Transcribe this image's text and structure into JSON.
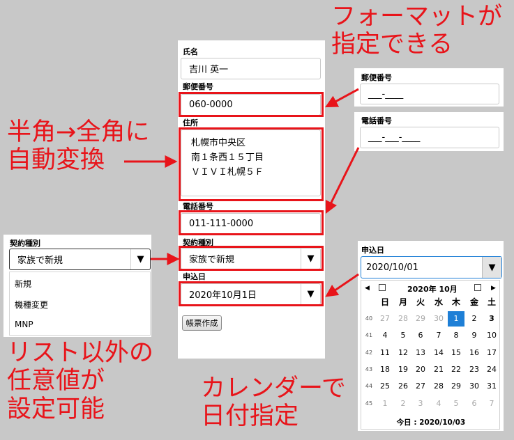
{
  "main_form": {
    "name_label": "氏名",
    "name_value": "吉川 英一",
    "postal_label": "郵便番号",
    "postal_value": "060-0000",
    "address_label": "住所",
    "address_lines": [
      "札幌市中央区",
      "南１条西１５丁目",
      "ＶＩＶＩ札幌５Ｆ"
    ],
    "phone_label": "電話番号",
    "phone_value": "011-111-0000",
    "contract_label": "契約種別",
    "contract_value": "家族で新規",
    "apply_label": "申込日",
    "apply_value": "2020年10月1日",
    "create_button": "帳票作成",
    "dropdown_glyph": "▼"
  },
  "postal_panel": {
    "label": "郵便番号",
    "value": "___-____"
  },
  "phone_panel": {
    "label": "電話番号",
    "value": "___-___-____"
  },
  "contract_panel": {
    "label": "契約種別",
    "value": "家族で新規",
    "options": [
      "新規",
      "機種変更",
      "MNP"
    ]
  },
  "calendar_panel": {
    "label": "申込日",
    "value": "2020/10/01",
    "month_title": "2020年 10月",
    "weekdays": [
      "日",
      "月",
      "火",
      "水",
      "木",
      "金",
      "土"
    ],
    "weeks": [
      {
        "wk": "40",
        "days": [
          "27",
          "28",
          "29",
          "30",
          "1",
          "2",
          "3"
        ]
      },
      {
        "wk": "41",
        "days": [
          "4",
          "5",
          "6",
          "7",
          "8",
          "9",
          "10"
        ]
      },
      {
        "wk": "42",
        "days": [
          "11",
          "12",
          "13",
          "14",
          "15",
          "16",
          "17"
        ]
      },
      {
        "wk": "43",
        "days": [
          "18",
          "19",
          "20",
          "21",
          "22",
          "23",
          "24"
        ]
      },
      {
        "wk": "44",
        "days": [
          "25",
          "26",
          "27",
          "28",
          "29",
          "30",
          "31"
        ]
      },
      {
        "wk": "45",
        "days": [
          "1",
          "2",
          "3",
          "4",
          "5",
          "6",
          "7"
        ]
      }
    ],
    "selected": "1",
    "today_text": "今日 : 2020/10/03",
    "prev_arrow": "◀",
    "next_arrow": "▶"
  },
  "callouts": {
    "format_line1": "フォーマットが",
    "format_line2": "指定できる",
    "convert_line1": "半角→全角に",
    "convert_line2": "自動変換",
    "list_line1": "リスト以外の",
    "list_line2": "任意値が",
    "list_line3": "設定可能",
    "calendar_line1": "カレンダーで",
    "calendar_line2": "日付指定"
  },
  "colors": {
    "accent_red": "#e8141a",
    "selected_day": "#1e7fd6"
  }
}
